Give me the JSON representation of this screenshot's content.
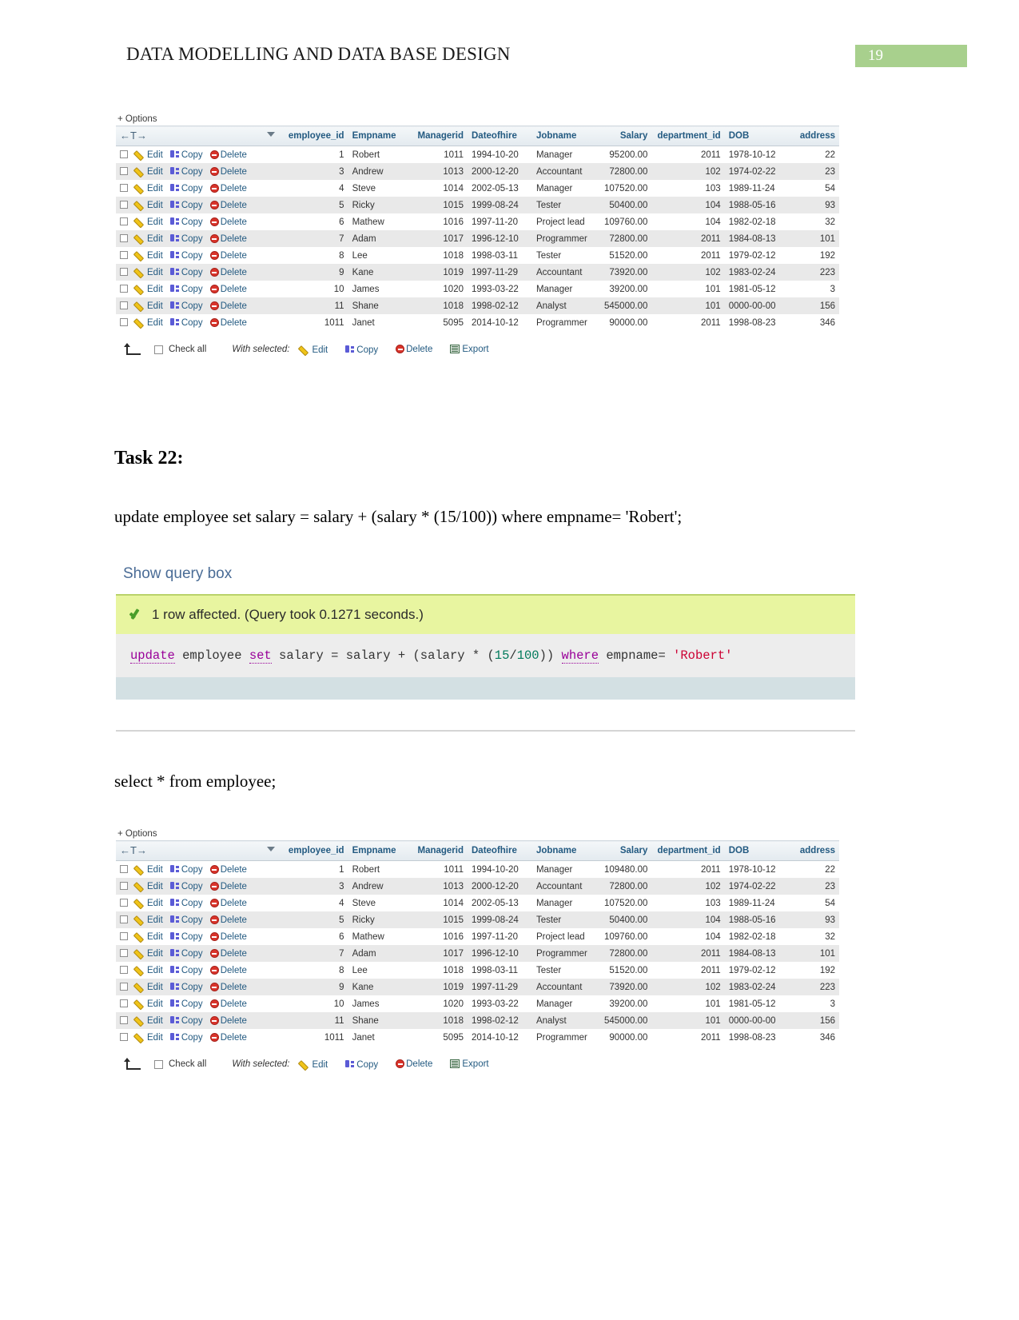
{
  "header": {
    "doc_title": "DATA MODELLING AND DATA BASE DESIGN",
    "page_number": "19"
  },
  "table_columns": [
    "employee_id",
    "Empname",
    "Managerid",
    "Dateofhire",
    "Jobname",
    "Salary",
    "department_id",
    "DOB",
    "address"
  ],
  "row_actions": {
    "edit": "Edit",
    "copy": "Copy",
    "delete": "Delete"
  },
  "options_label": "+ Options",
  "nav_arrows": "←T→",
  "footer": {
    "check_all": "Check all",
    "with_selected": "With selected:",
    "edit": "Edit",
    "copy": "Copy",
    "delete": "Delete",
    "export": "Export"
  },
  "table_before": {
    "rows": [
      {
        "employee_id": "1",
        "empname": "Robert",
        "managerid": "1011",
        "dateofhire": "1994-10-20",
        "jobname": "Manager",
        "salary": "95200.00",
        "department_id": "2011",
        "dob": "1978-10-12",
        "address": "22"
      },
      {
        "employee_id": "3",
        "empname": "Andrew",
        "managerid": "1013",
        "dateofhire": "2000-12-20",
        "jobname": "Accountant",
        "salary": "72800.00",
        "department_id": "102",
        "dob": "1974-02-22",
        "address": "23"
      },
      {
        "employee_id": "4",
        "empname": "Steve",
        "managerid": "1014",
        "dateofhire": "2002-05-13",
        "jobname": "Manager",
        "salary": "107520.00",
        "department_id": "103",
        "dob": "1989-11-24",
        "address": "54"
      },
      {
        "employee_id": "5",
        "empname": "Ricky",
        "managerid": "1015",
        "dateofhire": "1999-08-24",
        "jobname": "Tester",
        "salary": "50400.00",
        "department_id": "104",
        "dob": "1988-05-16",
        "address": "93"
      },
      {
        "employee_id": "6",
        "empname": "Mathew",
        "managerid": "1016",
        "dateofhire": "1997-11-20",
        "jobname": "Project lead",
        "salary": "109760.00",
        "department_id": "104",
        "dob": "1982-02-18",
        "address": "32"
      },
      {
        "employee_id": "7",
        "empname": "Adam",
        "managerid": "1017",
        "dateofhire": "1996-12-10",
        "jobname": "Programmer",
        "salary": "72800.00",
        "department_id": "2011",
        "dob": "1984-08-13",
        "address": "101"
      },
      {
        "employee_id": "8",
        "empname": "Lee",
        "managerid": "1018",
        "dateofhire": "1998-03-11",
        "jobname": "Tester",
        "salary": "51520.00",
        "department_id": "2011",
        "dob": "1979-02-12",
        "address": "192"
      },
      {
        "employee_id": "9",
        "empname": "Kane",
        "managerid": "1019",
        "dateofhire": "1997-11-29",
        "jobname": "Accountant",
        "salary": "73920.00",
        "department_id": "102",
        "dob": "1983-02-24",
        "address": "223"
      },
      {
        "employee_id": "10",
        "empname": "James",
        "managerid": "1020",
        "dateofhire": "1993-03-22",
        "jobname": "Manager",
        "salary": "39200.00",
        "department_id": "101",
        "dob": "1981-05-12",
        "address": "3"
      },
      {
        "employee_id": "11",
        "empname": "Shane",
        "managerid": "1018",
        "dateofhire": "1998-02-12",
        "jobname": "Analyst",
        "salary": "545000.00",
        "department_id": "101",
        "dob": "0000-00-00",
        "address": "156"
      },
      {
        "employee_id": "1011",
        "empname": "Janet",
        "managerid": "5095",
        "dateofhire": "2014-10-12",
        "jobname": "Programmer",
        "salary": "90000.00",
        "department_id": "2011",
        "dob": "1998-08-23",
        "address": "346"
      }
    ]
  },
  "task": {
    "heading": "Task 22:",
    "statement": "update employee set salary = salary + (salary * (15/100)) where empname= 'Robert';"
  },
  "query_panel": {
    "show_query_box": "Show query box",
    "status": "1 row affected. (Query took 0.1271 seconds.)",
    "sql_tokens": [
      {
        "t": "update",
        "k": "kw"
      },
      {
        "t": " employee ",
        "k": "plain"
      },
      {
        "t": "set",
        "k": "kw"
      },
      {
        "t": " salary = salary + (salary * (",
        "k": "plain"
      },
      {
        "t": "15",
        "k": "num"
      },
      {
        "t": "/",
        "k": "plain"
      },
      {
        "t": "100",
        "k": "num"
      },
      {
        "t": ")) ",
        "k": "plain"
      },
      {
        "t": "where",
        "k": "kw"
      },
      {
        "t": " empname= ",
        "k": "plain"
      },
      {
        "t": "'Robert'",
        "k": "str"
      }
    ],
    "sql_text": "update employee set salary = salary + (salary * (15/100)) where empname= 'Robert'"
  },
  "select_statement": "select * from employee;",
  "table_after": {
    "rows": [
      {
        "employee_id": "1",
        "empname": "Robert",
        "managerid": "1011",
        "dateofhire": "1994-10-20",
        "jobname": "Manager",
        "salary": "109480.00",
        "department_id": "2011",
        "dob": "1978-10-12",
        "address": "22"
      },
      {
        "employee_id": "3",
        "empname": "Andrew",
        "managerid": "1013",
        "dateofhire": "2000-12-20",
        "jobname": "Accountant",
        "salary": "72800.00",
        "department_id": "102",
        "dob": "1974-02-22",
        "address": "23"
      },
      {
        "employee_id": "4",
        "empname": "Steve",
        "managerid": "1014",
        "dateofhire": "2002-05-13",
        "jobname": "Manager",
        "salary": "107520.00",
        "department_id": "103",
        "dob": "1989-11-24",
        "address": "54"
      },
      {
        "employee_id": "5",
        "empname": "Ricky",
        "managerid": "1015",
        "dateofhire": "1999-08-24",
        "jobname": "Tester",
        "salary": "50400.00",
        "department_id": "104",
        "dob": "1988-05-16",
        "address": "93"
      },
      {
        "employee_id": "6",
        "empname": "Mathew",
        "managerid": "1016",
        "dateofhire": "1997-11-20",
        "jobname": "Project lead",
        "salary": "109760.00",
        "department_id": "104",
        "dob": "1982-02-18",
        "address": "32"
      },
      {
        "employee_id": "7",
        "empname": "Adam",
        "managerid": "1017",
        "dateofhire": "1996-12-10",
        "jobname": "Programmer",
        "salary": "72800.00",
        "department_id": "2011",
        "dob": "1984-08-13",
        "address": "101"
      },
      {
        "employee_id": "8",
        "empname": "Lee",
        "managerid": "1018",
        "dateofhire": "1998-03-11",
        "jobname": "Tester",
        "salary": "51520.00",
        "department_id": "2011",
        "dob": "1979-02-12",
        "address": "192"
      },
      {
        "employee_id": "9",
        "empname": "Kane",
        "managerid": "1019",
        "dateofhire": "1997-11-29",
        "jobname": "Accountant",
        "salary": "73920.00",
        "department_id": "102",
        "dob": "1983-02-24",
        "address": "223"
      },
      {
        "employee_id": "10",
        "empname": "James",
        "managerid": "1020",
        "dateofhire": "1993-03-22",
        "jobname": "Manager",
        "salary": "39200.00",
        "department_id": "101",
        "dob": "1981-05-12",
        "address": "3"
      },
      {
        "employee_id": "11",
        "empname": "Shane",
        "managerid": "1018",
        "dateofhire": "1998-02-12",
        "jobname": "Analyst",
        "salary": "545000.00",
        "department_id": "101",
        "dob": "0000-00-00",
        "address": "156"
      },
      {
        "employee_id": "1011",
        "empname": "Janet",
        "managerid": "5095",
        "dateofhire": "2014-10-12",
        "jobname": "Programmer",
        "salary": "90000.00",
        "department_id": "2011",
        "dob": "1998-08-23",
        "address": "346"
      }
    ]
  },
  "colors": {
    "page_badge": "#a8d08d",
    "link": "#235a81",
    "success_bg": "#e8f5a0",
    "sql_bg": "#ededed",
    "sql_foot": "#d3e0e3"
  }
}
